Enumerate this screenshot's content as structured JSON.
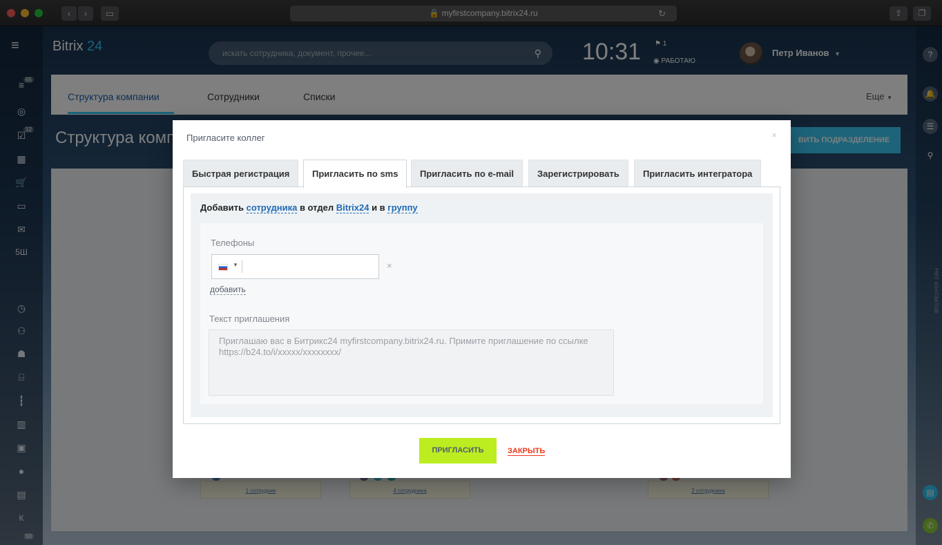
{
  "browser": {
    "url": "myfirstcompany.bitrix24.ru",
    "lock_icon": "lock-icon",
    "back_icon": "chevron-left-icon",
    "forward_icon": "chevron-right-icon",
    "sidebar_icon": "sidebar-icon",
    "reload_icon": "reload-icon",
    "share_icon": "share-icon",
    "tabs_icon": "tabs-icon"
  },
  "header": {
    "logo_text": "Bitrix",
    "logo_num": "24",
    "search_placeholder": "искать сотрудника, документ, прочее...",
    "clock": "10:31",
    "flag_count": "1",
    "work_status": "РАБОТАЮ",
    "user_name": "Петр Иванов"
  },
  "left_sidebar": {
    "badges": [
      "65",
      "12",
      "50"
    ],
    "labels": [
      "5Ш",
      "К"
    ]
  },
  "right_sidebar": {
    "vertical_text": "Нет контактов"
  },
  "page": {
    "tabs": [
      "Структура компании",
      "Сотрудники",
      "Списки"
    ],
    "more": "Еще",
    "title": "Структура комп",
    "add_department": "ВИТЬ ПОДРАЗДЕЛЕНИЕ",
    "cards": [
      "1 сотрудник",
      "4 сотрудника",
      "2 сотрудника"
    ]
  },
  "dialog": {
    "title": "Пригласите коллег",
    "tabs": [
      "Быстрая регистрация",
      "Пригласить по sms",
      "Пригласить по e-mail",
      "Зарегистрировать",
      "Пригласить интегратора"
    ],
    "active_tab": 1,
    "add_prefix": "Добавить",
    "add_employee_link": "сотрудника",
    "add_mid": "в отдел",
    "add_dept_link": "Bitrix24",
    "add_and": "и в",
    "add_group_link": "группу",
    "phones_label": "Телефоны",
    "add_phone": "добавить",
    "invite_text_label": "Текст приглашения",
    "invite_text": "Приглашаю вас в Битрикс24 myfirstcompany.bitrix24.ru. Примите приглашение по ссылке https://b24.to/i/xxxxx/xxxxxxxx/",
    "invite_button": "ПРИГЛАСИТЬ",
    "close_button": "ЗАКРЫТЬ"
  },
  "colors": {
    "accent": "#2fc6f6",
    "invite_button": "#bbed21",
    "close_link": "#f0371b",
    "link": "#1f6ab5"
  }
}
